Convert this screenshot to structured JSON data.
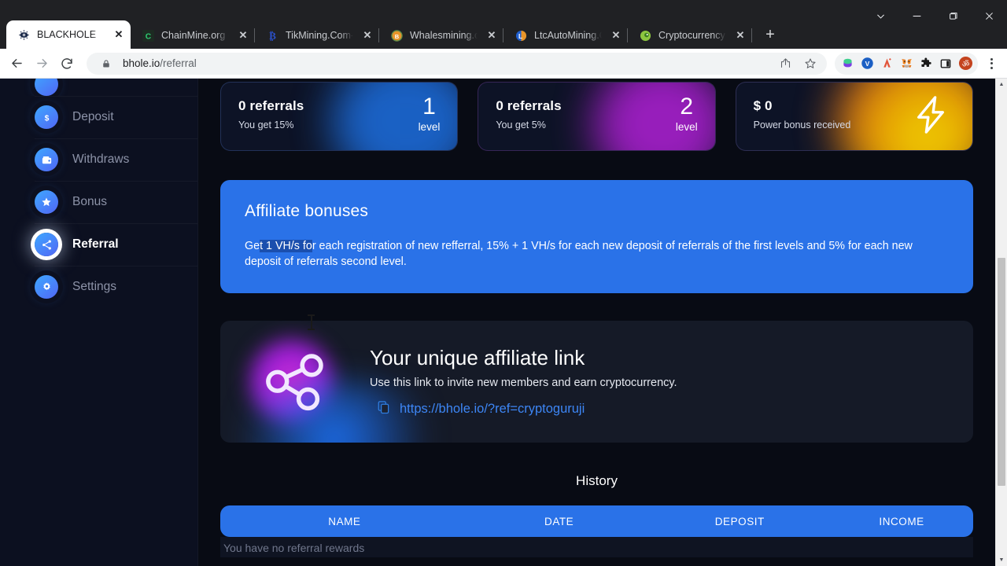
{
  "browser": {
    "tabs": [
      {
        "title": "BLACKHOLE",
        "favicon": "blackhole-eye-icon",
        "active": true
      },
      {
        "title": "ChainMine.org - Mi",
        "favicon": "chainmine-c-icon",
        "active": false
      },
      {
        "title": "TikMining.Com-Min",
        "favicon": "bitcoin-b-icon",
        "active": false
      },
      {
        "title": "Whalesmining.com",
        "favicon": "whalesmining-b-icon",
        "active": false
      },
      {
        "title": "LtcAutoMining.Com",
        "favicon": "litecoin-l-icon",
        "active": false
      },
      {
        "title": "Cryptocurrency Pric",
        "favicon": "coingecko-icon",
        "active": false
      }
    ],
    "new_tab_label": "+",
    "close_label": "✕",
    "window_controls": [
      "tab-search-chevron-icon",
      "minimize-icon",
      "maximize-icon",
      "close-icon"
    ],
    "address": {
      "domain": "bhole.io",
      "path": "/referral",
      "lock": "lock-icon"
    },
    "nav": {
      "back": "back-arrow-icon",
      "forward": "forward-arrow-icon",
      "reload": "reload-icon"
    },
    "omnibox_actions": [
      "share-icon",
      "bookmark-star-icon"
    ],
    "extensions": [
      "wallet-extension-icon",
      "vpn-v-extension-icon",
      "autofill-a-extension-icon",
      "metamask-fox-icon",
      "puzzle-extensions-icon",
      "sidepanel-icon",
      "profile-om-avatar"
    ],
    "menu": "kebab-menu-icon"
  },
  "sidebar": {
    "items": [
      {
        "label": "",
        "icon": "partial-icon"
      },
      {
        "label": "Deposit",
        "icon": "dollar-icon",
        "active": false
      },
      {
        "label": "Withdraws",
        "icon": "wallet-icon",
        "active": false
      },
      {
        "label": "Bonus",
        "icon": "star-icon",
        "active": false
      },
      {
        "label": "Referral",
        "icon": "share-nodes-icon",
        "active": true
      },
      {
        "label": "Settings",
        "icon": "gear-icon",
        "active": false
      }
    ]
  },
  "cards": [
    {
      "title": "0 referrals",
      "subtitle": "You get 15%",
      "value": "1",
      "unit": "level",
      "accent": "#1d6fe0"
    },
    {
      "title": "0 referrals",
      "subtitle": "You get 5%",
      "value": "2",
      "unit": "level",
      "accent": "#b020d6"
    },
    {
      "title": "$ 0",
      "subtitle": "Power bonus received",
      "value": "",
      "unit": "",
      "icon": "lightning-bolt-icon",
      "accent": "#ffc400"
    }
  ],
  "banner": {
    "heading": "Affiliate bonuses",
    "text_before": "Ge",
    "text_selected": "t 1 VH/s fo",
    "text_after": "r each registration of new refferral, 15% + 1 VH/s for each new deposit of referrals of the first levels and 5% for each new deposit of referrals second level.",
    "bg": "#2a72e8",
    "selection_bg": "#1b4fae"
  },
  "affiliate_link_card": {
    "heading": "Your unique affiliate link",
    "subheading": "Use this link to invite new members and earn cryptocurrency.",
    "link": "https://bhole.io/?ref=cryptoguruji",
    "copy_icon": "copy-icon",
    "share_icon": "share-nodes-icon",
    "link_color": "#3d86f5"
  },
  "history": {
    "title": "History",
    "columns": [
      "NAME",
      "DATE",
      "DEPOSIT",
      "INCOME"
    ],
    "empty_message": "You have no referral rewards",
    "header_bg": "#2a72e8"
  }
}
